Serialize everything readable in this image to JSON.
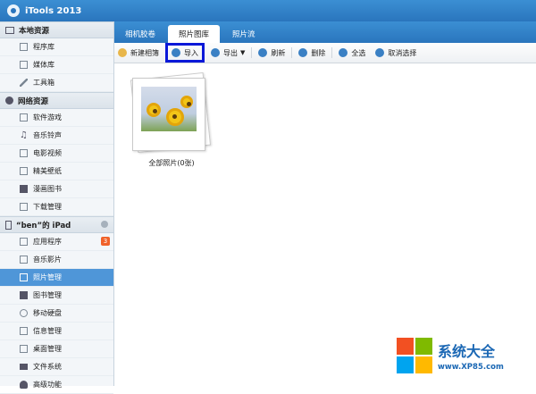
{
  "app": {
    "title": "iTools 2013"
  },
  "sidebar": {
    "local_title": "本地资源",
    "local_items": [
      {
        "label": "程序库"
      },
      {
        "label": "媒体库"
      },
      {
        "label": "工具箱"
      }
    ],
    "network_title": "网络资源",
    "network_items": [
      {
        "label": "软件游戏"
      },
      {
        "label": "音乐铃声"
      },
      {
        "label": "电影视频"
      },
      {
        "label": "精美壁纸"
      },
      {
        "label": "漫画图书"
      },
      {
        "label": "下载管理"
      }
    ],
    "device_title": "“ben”的 iPad",
    "device_items": [
      {
        "label": "应用程序",
        "badge": "3"
      },
      {
        "label": "音乐影片"
      },
      {
        "label": "照片管理"
      },
      {
        "label": "图书管理"
      },
      {
        "label": "移动硬盘"
      },
      {
        "label": "信息管理"
      },
      {
        "label": "桌面管理"
      },
      {
        "label": "文件系统"
      },
      {
        "label": "高级功能"
      }
    ]
  },
  "tabs": [
    {
      "label": "相机胶卷"
    },
    {
      "label": "照片图库"
    },
    {
      "label": "照片流"
    }
  ],
  "toolbar": {
    "new_album": "新建相簿",
    "import": "导入",
    "export": "导出",
    "refresh": "刷新",
    "delete": "删除",
    "select_all": "全选",
    "deselect": "取消选择"
  },
  "album": {
    "label": "全部照片(0张)"
  },
  "watermark": {
    "title": "系统大全",
    "url": "www.XP85.com"
  },
  "colors": {
    "accent": "#2a75bd",
    "highlight_box": "#0a18d8",
    "active_item": "#4f96d8"
  }
}
